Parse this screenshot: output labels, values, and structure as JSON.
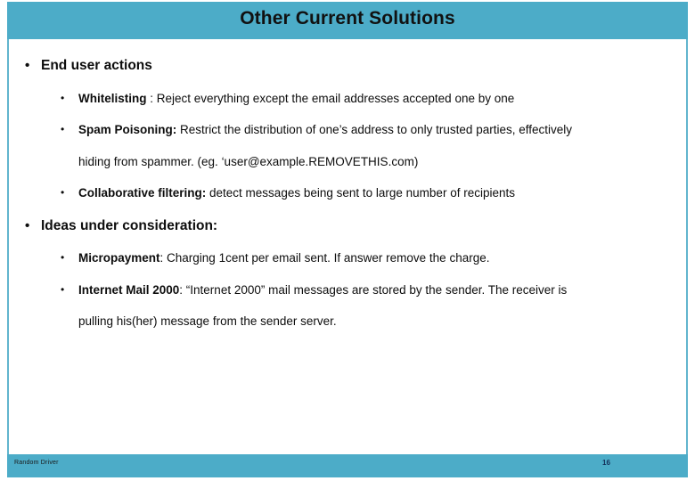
{
  "slide": {
    "title": "Other Current Solutions",
    "accent_color": "#4CACC8",
    "rule_color": "#62B5CE",
    "text_color": "#0d0d0d",
    "background_color": "#ffffff"
  },
  "bullets": {
    "glyph_level1": "•",
    "glyph_level2": "•"
  },
  "sections": [
    {
      "heading": "End user actions",
      "items": [
        {
          "lead": "Whitelisting",
          "rest": " : Reject everything except the email addresses accepted one by one",
          "continuation": null
        },
        {
          "lead": "Spam Poisoning:",
          "rest": " Restrict the distribution of one’s address to only trusted parties, effectively",
          "continuation": "hiding from spammer. (eg. ‘user@example.REMOVETHIS.com)"
        },
        {
          "lead": "  Collaborative filtering:",
          "rest": "  detect messages being sent to large number of recipients",
          "continuation": null
        }
      ]
    },
    {
      "heading": "Ideas under consideration:",
      "items": [
        {
          "lead": "Micropayment",
          "rest": ": Charging 1cent per email sent. If answer remove the charge.",
          "continuation": null
        },
        {
          "lead": "Internet Mail 2000",
          "rest": ": “Internet 2000”  mail messages are stored by the sender. The receiver is",
          "continuation": "pulling his(her) message from the sender server."
        }
      ]
    }
  ],
  "footer": {
    "left_label": "Random Driver",
    "page_number": "16"
  }
}
